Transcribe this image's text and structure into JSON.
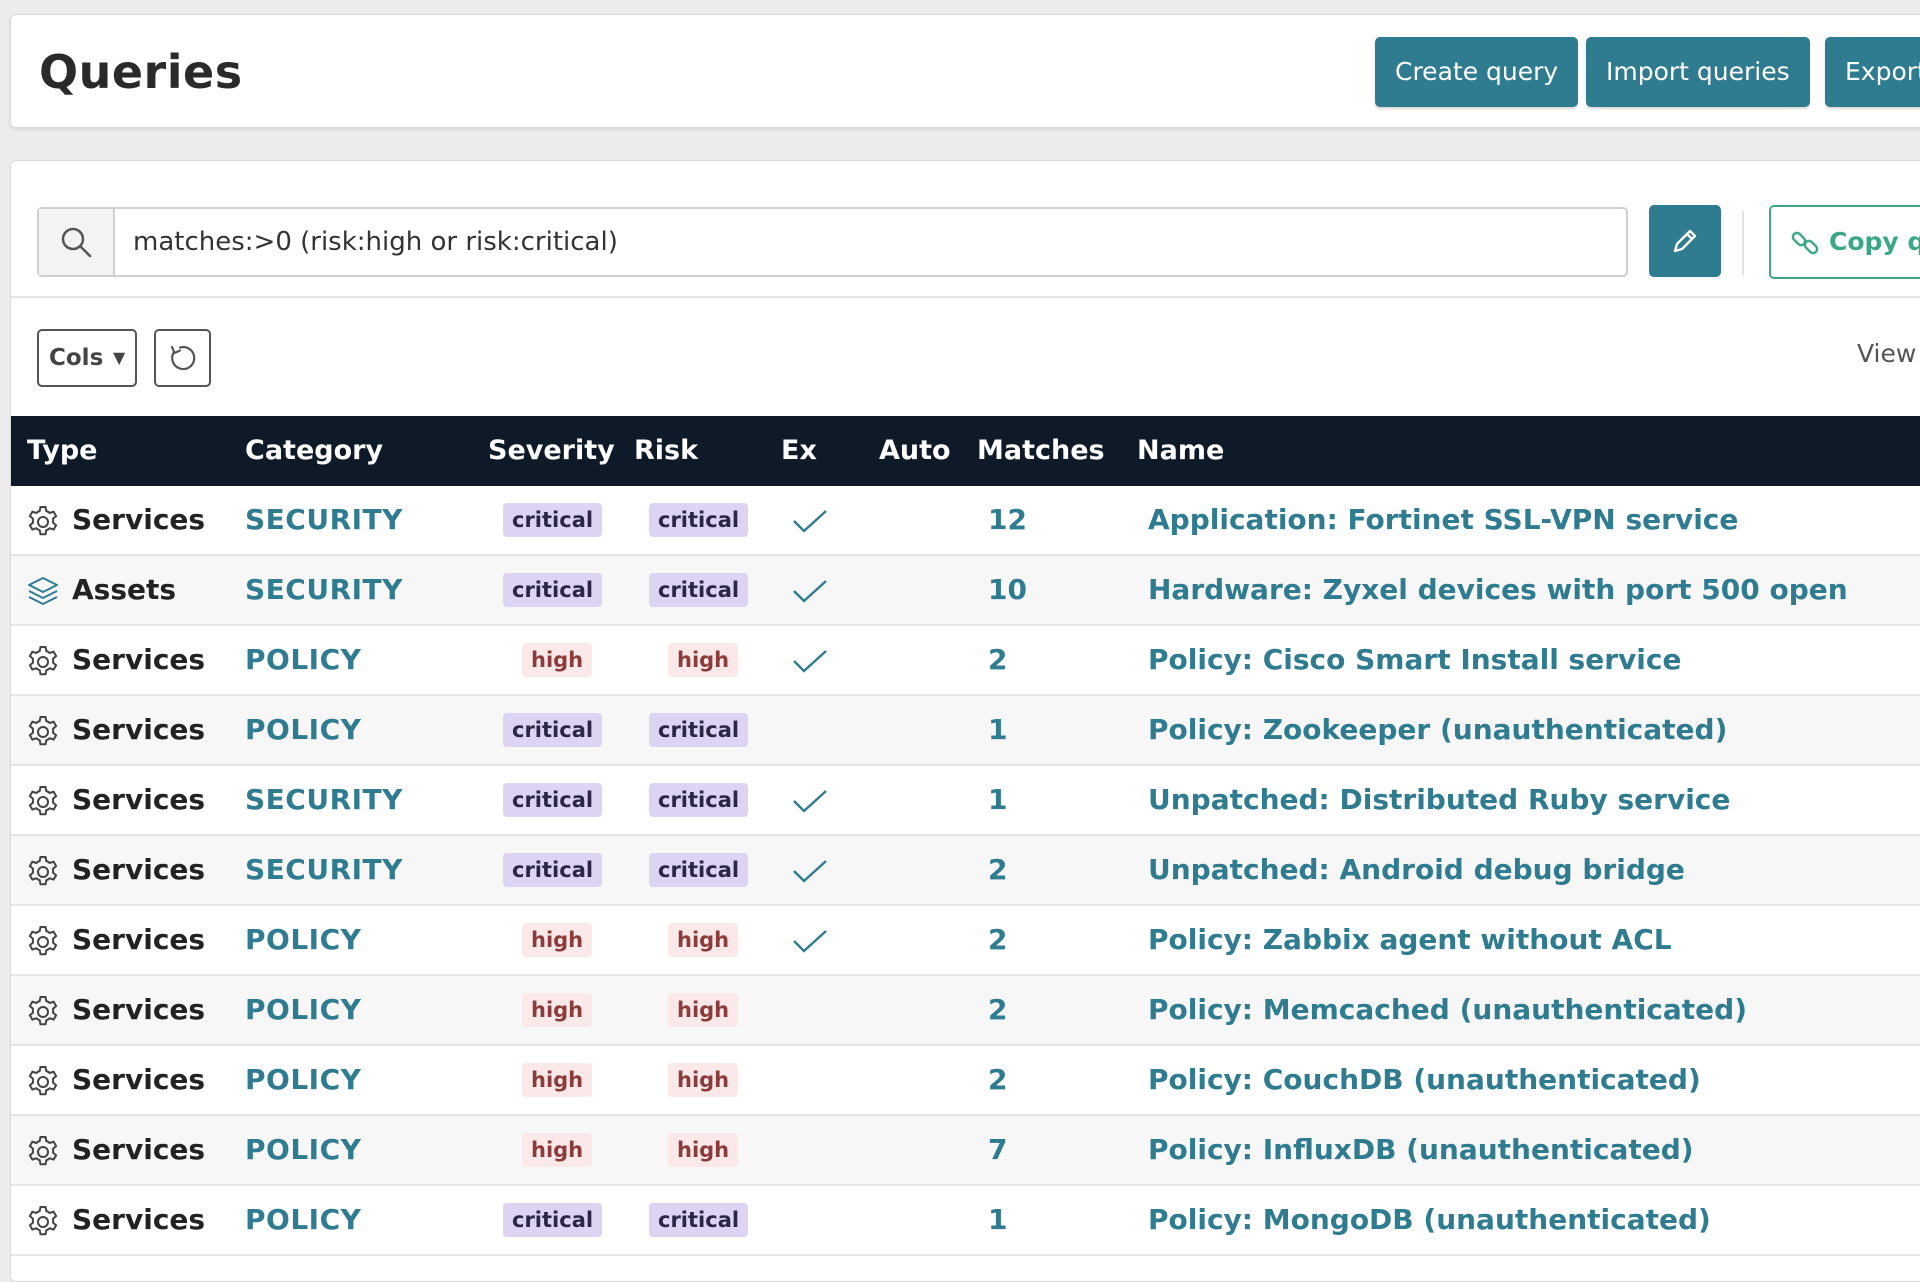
{
  "header": {
    "title": "Queries",
    "buttons": [
      "Create query",
      "Import queries",
      "Export"
    ]
  },
  "search": {
    "value": "matches:>0 (risk:high or risk:critical)"
  },
  "toolbar": {
    "copy_label": "Copy q",
    "cols_label": "Cols",
    "view_label": "View"
  },
  "table": {
    "columns": [
      "Type",
      "Category",
      "Severity",
      "Risk",
      "Ex",
      "Auto",
      "Matches",
      "Name"
    ],
    "rows": [
      {
        "type": "Services",
        "category": "SECURITY",
        "severity": "critical",
        "risk": "critical",
        "ex": true,
        "matches": "12",
        "name": "Application: Fortinet SSL-VPN service"
      },
      {
        "type": "Assets",
        "category": "SECURITY",
        "severity": "critical",
        "risk": "critical",
        "ex": true,
        "matches": "10",
        "name": "Hardware: Zyxel devices with port 500 open"
      },
      {
        "type": "Services",
        "category": "POLICY",
        "severity": "high",
        "risk": "high",
        "ex": true,
        "matches": "2",
        "name": "Policy: Cisco Smart Install service"
      },
      {
        "type": "Services",
        "category": "POLICY",
        "severity": "critical",
        "risk": "critical",
        "ex": false,
        "matches": "1",
        "name": "Policy: Zookeeper (unauthenticated)"
      },
      {
        "type": "Services",
        "category": "SECURITY",
        "severity": "critical",
        "risk": "critical",
        "ex": true,
        "matches": "1",
        "name": "Unpatched: Distributed Ruby service"
      },
      {
        "type": "Services",
        "category": "SECURITY",
        "severity": "critical",
        "risk": "critical",
        "ex": true,
        "matches": "2",
        "name": "Unpatched: Android debug bridge"
      },
      {
        "type": "Services",
        "category": "POLICY",
        "severity": "high",
        "risk": "high",
        "ex": true,
        "matches": "2",
        "name": "Policy: Zabbix agent without ACL"
      },
      {
        "type": "Services",
        "category": "POLICY",
        "severity": "high",
        "risk": "high",
        "ex": false,
        "matches": "2",
        "name": "Policy: Memcached (unauthenticated)"
      },
      {
        "type": "Services",
        "category": "POLICY",
        "severity": "high",
        "risk": "high",
        "ex": false,
        "matches": "2",
        "name": "Policy: CouchDB (unauthenticated)"
      },
      {
        "type": "Services",
        "category": "POLICY",
        "severity": "high",
        "risk": "high",
        "ex": false,
        "matches": "7",
        "name": "Policy: InfluxDB (unauthenticated)"
      },
      {
        "type": "Services",
        "category": "POLICY",
        "severity": "critical",
        "risk": "critical",
        "ex": false,
        "matches": "1",
        "name": "Policy: MongoDB (unauthenticated)"
      }
    ]
  },
  "icons": {
    "services": "gear-icon",
    "assets": "layers-icon",
    "ex": "check-icon"
  },
  "colors": {
    "accent": "#2f7b8f",
    "header_bg": "#0e1a28",
    "critical_badge_bg": "#ddd3f2",
    "high_badge_bg": "#fbe9e9",
    "copy_green": "#3aa886"
  }
}
